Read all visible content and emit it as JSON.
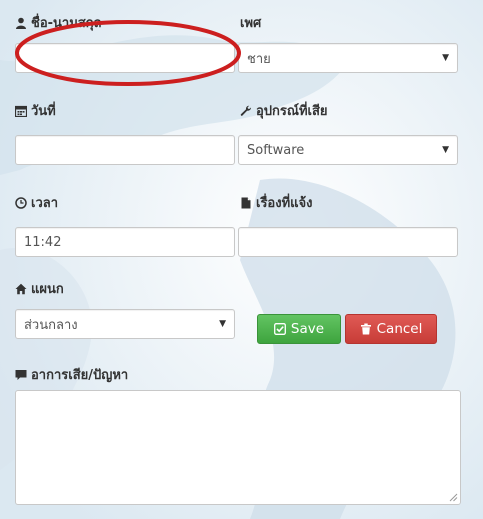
{
  "form": {
    "name": {
      "label": "ชื่อ-นามสกุล",
      "value": ""
    },
    "gender": {
      "label": "เพศ",
      "selected": "ชาย"
    },
    "date": {
      "label": "วันที่",
      "value": ""
    },
    "device": {
      "label": "อุปกรณ์ที่เสีย",
      "selected": "Software"
    },
    "time": {
      "label": "เวลา",
      "value": "11:42"
    },
    "subject": {
      "label": "เรื่องที่แจ้ง",
      "value": ""
    },
    "department": {
      "label": "แผนก",
      "selected": "ส่วนกลาง"
    },
    "problem": {
      "label": "อาการเสีย/ปัญหา",
      "value": ""
    }
  },
  "buttons": {
    "save": "Save",
    "cancel": "Cancel"
  },
  "colors": {
    "save": "#4cb04c",
    "cancel": "#d9534f",
    "annotation": "#cc1f1f"
  },
  "icons": [
    "user-icon",
    "calendar-icon",
    "wrench-icon",
    "clock-icon",
    "file-icon",
    "home-icon",
    "comment-icon",
    "check-icon",
    "trash-icon",
    "caret-down-icon"
  ]
}
